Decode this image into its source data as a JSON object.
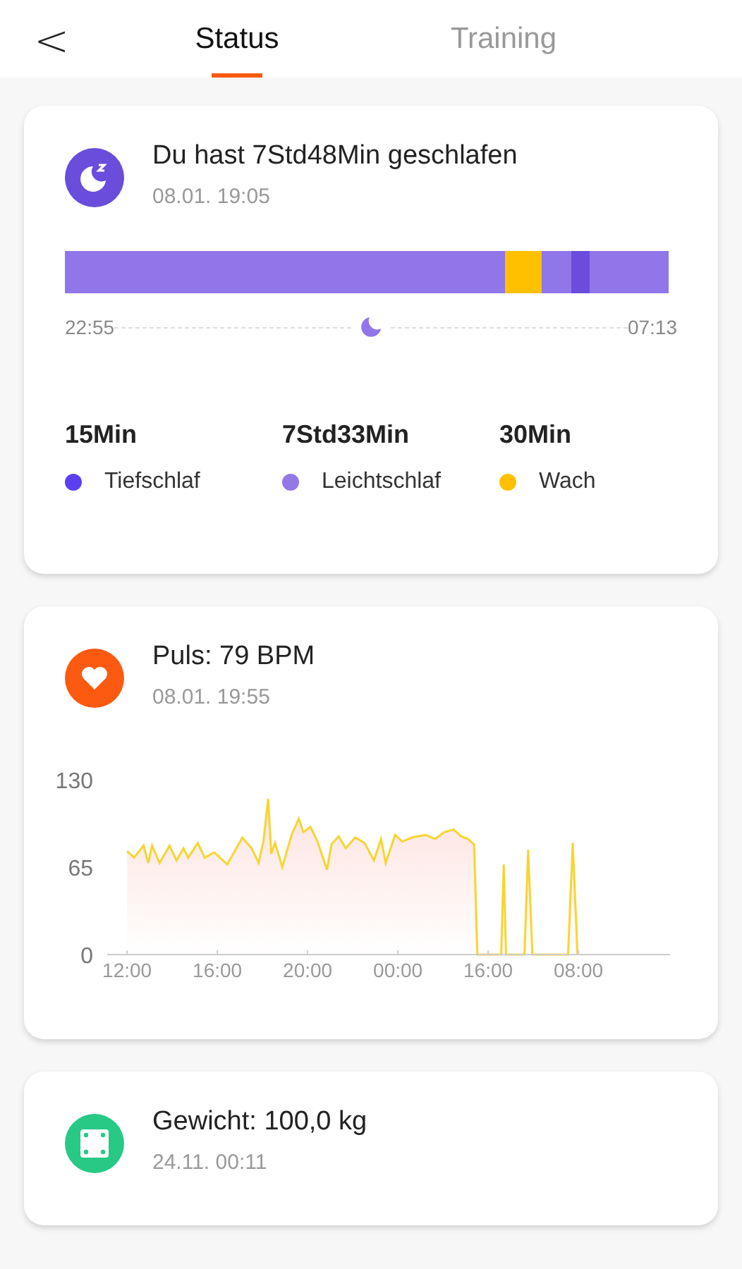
{
  "header": {
    "back": "<",
    "tabs": [
      {
        "label": "Status",
        "selected": true
      },
      {
        "label": "Training",
        "selected": false
      }
    ]
  },
  "cards": [
    {
      "kind": "sleep",
      "title": "Du hast 7Std48Min geschlafen",
      "time": "08.01. 19:05",
      "start": "22:55",
      "end": "07:13",
      "stages": [
        {
          "value": "15Min",
          "label": "Tiefschlaf",
          "color": "#5b3ff0"
        },
        {
          "value": "7Std33Min",
          "label": "Leichtschlaf",
          "color": "#9378e8"
        },
        {
          "value": "30Min",
          "label": "Wach",
          "color": "#ffc000"
        }
      ]
    },
    {
      "kind": "pulse",
      "title": "Puls: 79 BPM",
      "time": "08.01. 19:55",
      "chart_data": {
        "type": "area",
        "x": [
          12.0,
          12.31,
          12.73,
          12.94,
          13.11,
          13.44,
          13.88,
          14.19,
          14.5,
          14.71,
          15.13,
          15.44,
          15.86,
          16.44,
          17.11,
          17.52,
          17.83,
          18.04,
          18.25,
          18.39,
          18.56,
          18.88,
          19.29,
          19.61,
          19.81,
          20.13,
          20.44,
          20.86,
          21.06,
          21.38,
          21.69,
          22.11,
          22.52,
          22.94,
          23.25,
          23.46,
          23.88,
          24.19,
          24.61,
          25.23,
          25.64,
          26.06,
          26.48,
          26.79,
          27.11,
          27.38,
          27.52,
          28.58,
          28.69,
          28.79,
          29.61,
          29.77,
          29.96,
          31.54,
          31.75,
          31.96
        ],
        "series": [
          {
            "color": "#f7d531",
            "values": [
              77,
              72,
              81,
              68,
              81,
              68,
              81,
              70,
              79,
              72,
              83,
              72,
              76,
              67,
              87,
              79,
              68,
              84,
              116,
              75,
              83,
              65,
              89,
              101,
              91,
              95,
              84,
              63,
              82,
              88,
              79,
              87,
              83,
              70,
              86,
              68,
              89,
              84,
              87,
              89,
              86,
              91,
              93,
              88,
              86,
              82,
              0,
              0,
              67,
              0,
              0,
              78,
              0,
              0,
              83,
              0
            ]
          }
        ],
        "xlim": [
          11.12,
          36.06
        ],
        "ylim": [
          0,
          130
        ],
        "yticks": [
          0,
          65,
          130
        ],
        "xticks": [
          {
            "value": 12,
            "label": "12:00"
          },
          {
            "value": 16,
            "label": "16:00"
          },
          {
            "value": 20,
            "label": "20:00"
          },
          {
            "value": 24,
            "label": "00:00"
          }
        ]
      },
      "axis_labels_after_break": [
        "16:00",
        "08:00"
      ]
    },
    {
      "kind": "weight",
      "title": "Gewicht: 100,0 kg",
      "time": "24.11. 00:11"
    }
  ]
}
